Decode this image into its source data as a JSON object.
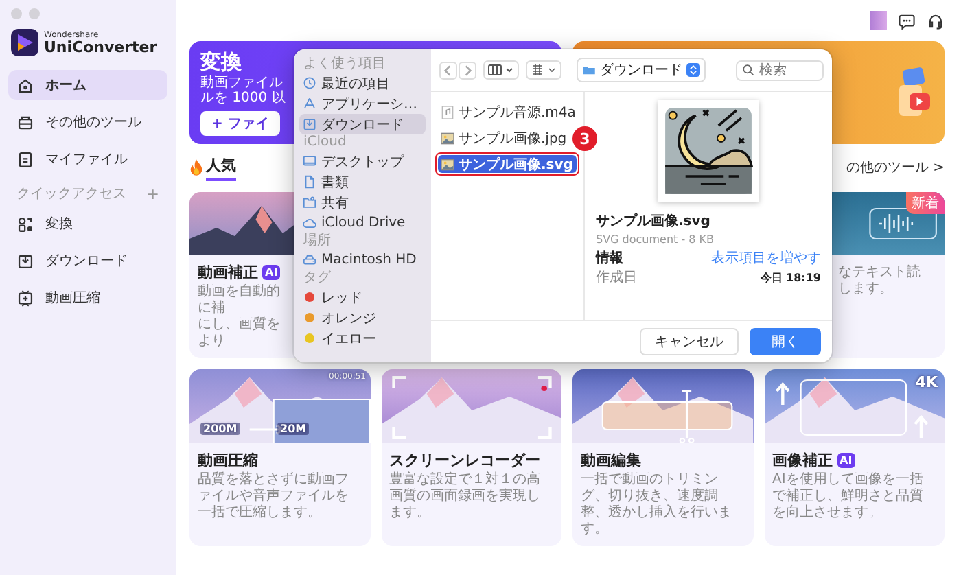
{
  "app": {
    "brand_small": "Wondershare",
    "brand": "UniConverter"
  },
  "sidebar": {
    "items": [
      {
        "label": "ホーム",
        "selected": true
      },
      {
        "label": "その他のツール",
        "selected": false
      },
      {
        "label": "マイファイル",
        "selected": false
      }
    ],
    "quick_access": {
      "title": "クイックアクセス",
      "add": "+",
      "items": [
        {
          "label": "変換",
          "selected": false
        },
        {
          "label": "ダウンロード",
          "selected": false
        },
        {
          "label": "動画圧縮",
          "selected": false
        }
      ]
    }
  },
  "banner": {
    "title": "変換",
    "description_lines": [
      "動画ファイル",
      "ルを 1000 以"
    ],
    "button": "+ ファイ"
  },
  "tabs": [
    {
      "label": "人気",
      "selected": true
    }
  ],
  "more_link": "の他のツール >",
  "featured_cards": [
    {
      "kind": "left",
      "title": "動画補正",
      "badge": "AI",
      "description_lines": [
        "動画を自動的に補",
        "にし、画質をより"
      ]
    },
    {
      "kind": "right",
      "tag": "新着",
      "description_lines": [
        "なテキスト読",
        "します。"
      ]
    }
  ],
  "tool_cards": [
    {
      "kind": "compress",
      "title": "動画圧縮",
      "description": "品質を落とさずに動画ファイルや音声ファイルを一括で圧縮します。",
      "image_labels": [
        "00:00:51",
        "200M",
        "20M"
      ]
    },
    {
      "kind": "recorder",
      "title": "スクリーンレコーダー",
      "description": "豊富な設定で１対１の高画質の画面録画を実現します。"
    },
    {
      "kind": "editor",
      "title": "動画編集",
      "description": "一括で動画のトリミング、切り抜き、速度調整、透かし挿入を行います。"
    },
    {
      "kind": "enhance",
      "title": "画像補正",
      "badge": "AI",
      "description": "AIを使用して画像を一括で補正し、鮮明さと品質を向上させます。",
      "image_labels": [
        "4K"
      ]
    }
  ],
  "file_dialog": {
    "sidebar": [
      {
        "title": "よく使う項目",
        "items": [
          {
            "label": "最近の項目",
            "selected": false
          },
          {
            "label": "アプリケーシ…",
            "selected": false
          },
          {
            "label": "ダウンロード",
            "selected": true
          }
        ]
      },
      {
        "title": "iCloud",
        "items": [
          {
            "label": "デスクトップ",
            "selected": false
          },
          {
            "label": "書類",
            "selected": false
          },
          {
            "label": "共有",
            "selected": false
          },
          {
            "label": "iCloud Drive",
            "selected": false
          }
        ]
      },
      {
        "title": "場所",
        "items": [
          {
            "label": "Macintosh HD",
            "selected": false
          }
        ]
      },
      {
        "title": "タグ",
        "items": [
          {
            "label": "レッド",
            "color": "#e5483b",
            "selected": false
          },
          {
            "label": "オレンジ",
            "color": "#e99a2c",
            "selected": false
          },
          {
            "label": "イエロー",
            "color": "#e8c521",
            "selected": false
          }
        ]
      }
    ],
    "location": "ダウンロード",
    "search_placeholder": "検索",
    "files": [
      {
        "name": "サンプル音源.m4a",
        "kind": "audio",
        "selected": false
      },
      {
        "name": "サンプル画像.jpg",
        "kind": "image",
        "selected": false
      },
      {
        "name": "サンプル画像.svg",
        "kind": "image",
        "selected": true
      }
    ],
    "preview": {
      "name": "サンプル画像.svg",
      "type": "SVG document - 8 KB",
      "info_label": "情報",
      "more_link": "表示項目を増やす",
      "created_label": "作成日",
      "created_value": "今日 18:19"
    },
    "buttons": [
      {
        "label": "キャンセル",
        "primary": false
      },
      {
        "label": "開く",
        "primary": true
      }
    ]
  },
  "annotation": {
    "number": "3"
  }
}
